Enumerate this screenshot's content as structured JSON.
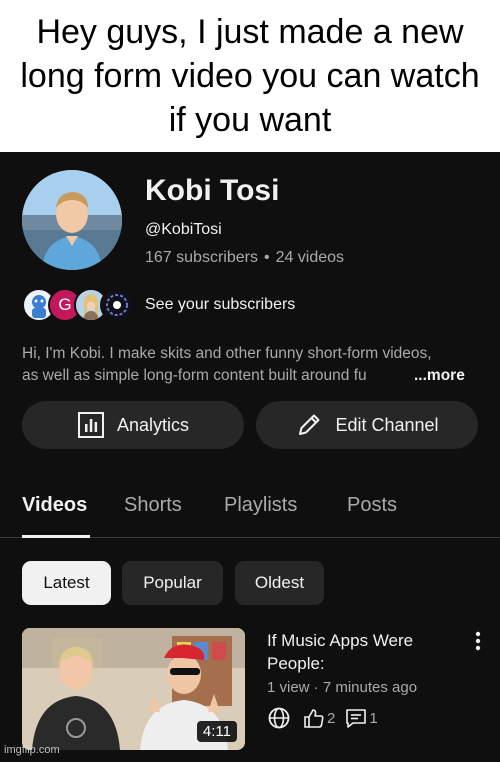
{
  "caption": "Hey guys, I just made a new long form video you can watch if you want",
  "channel": {
    "name": "Kobi Tosi",
    "handle": "@KobiTosi",
    "subscribers": "167 subscribers",
    "separator": "•",
    "videos": "24 videos",
    "see_subscribers": "See your subscribers",
    "description_line1": "Hi, I'm Kobi. I make skits and other funny short-form videos,",
    "description_line2": "as well as simple long-form content built around fu",
    "more_label": "...more"
  },
  "buttons": {
    "analytics": "Analytics",
    "edit_channel": "Edit Channel"
  },
  "tabs": [
    "Videos",
    "Shorts",
    "Playlists",
    "Posts"
  ],
  "chips": [
    "Latest",
    "Popular",
    "Oldest"
  ],
  "video": {
    "title": "If Music Apps Were People:",
    "meta": "1 view · 7 minutes ago",
    "duration": "4:11",
    "likes": "2",
    "comments": "1"
  },
  "watermark": "imgflip.com",
  "colors": {
    "background": "#0f0f0f",
    "surface": "#272727",
    "text": "#f1f1f1",
    "secondary_text": "#aaaaaa",
    "sub_avatar_g": "#c2185b"
  }
}
